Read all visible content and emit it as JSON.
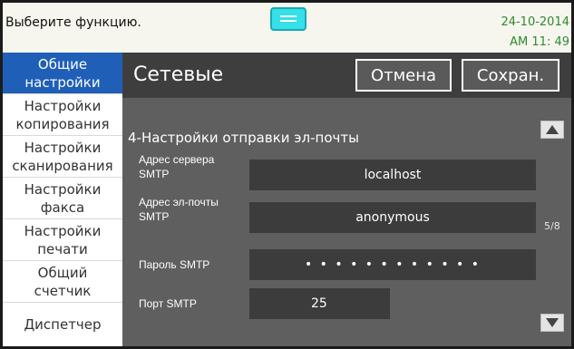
{
  "status": {
    "prompt": "Выберите функцию.",
    "date": "24-10-2014",
    "time": "AM 11: 49"
  },
  "sidebar": {
    "items": [
      {
        "line1": "Общие",
        "line2": "настройки",
        "active": true
      },
      {
        "line1": "Настройки",
        "line2": "копирования",
        "active": false
      },
      {
        "line1": "Настройки",
        "line2": "сканирования",
        "active": false
      },
      {
        "line1": "Настройки",
        "line2": "факса",
        "active": false
      },
      {
        "line1": "Настройки",
        "line2": "печати",
        "active": false
      },
      {
        "line1": "Общий",
        "line2": "счетчик",
        "active": false
      },
      {
        "line1": "Диспетчер",
        "line2": "",
        "active": false
      }
    ]
  },
  "header": {
    "title": "Сетевые",
    "cancel_label": "Отмена",
    "save_label": "Сохран."
  },
  "section": {
    "title": "4-Настройки отправки эл-почты"
  },
  "fields": {
    "server_label_1": "Адрес сервера",
    "server_label_2": "SMTP",
    "server_value": "localhost",
    "email_label_1": "Адрес эл-почты",
    "email_label_2": "SMTP",
    "email_value": "anonymous",
    "password_label": "Пароль SMTP",
    "password_value": "• • • • • • • • • • • •",
    "port_label": "Порт SMTP",
    "port_value": "25"
  },
  "pager": {
    "indicator": "5/8",
    "up_icon": "triangle-up-icon",
    "down_icon": "triangle-down-icon"
  },
  "colors": {
    "active_tab": "#1f5fb8",
    "header_bg": "#3e3e3e",
    "panel_bg": "#5f5f5f",
    "field_bg": "#3c3c3c",
    "clock_text": "#2f8a2f",
    "handle": "#35e0e8"
  }
}
